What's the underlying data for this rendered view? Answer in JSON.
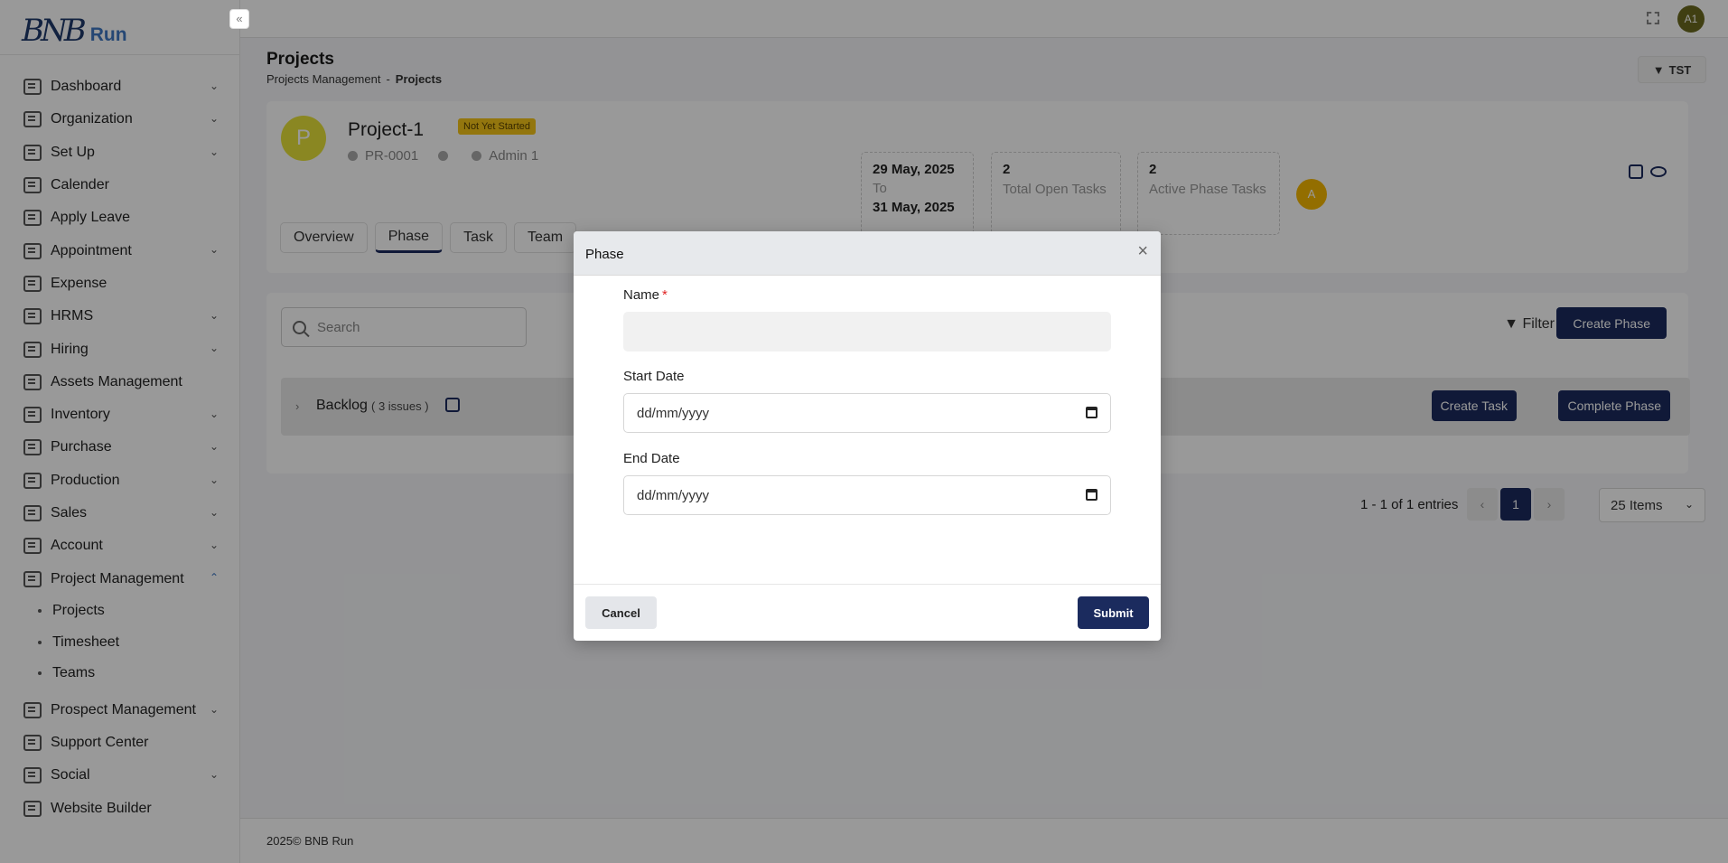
{
  "app": {
    "logo_mark": "BNB",
    "logo_text": "Run",
    "collapse_glyph": "«",
    "user_initials": "A1"
  },
  "sidebar": {
    "items": [
      {
        "label": "Dashboard",
        "icon": "dashboard-icon",
        "has_children": true
      },
      {
        "label": "Organization",
        "icon": "organization-icon",
        "has_children": true
      },
      {
        "label": "Set Up",
        "icon": "setup-icon",
        "has_children": true
      },
      {
        "label": "Calender",
        "icon": "calendar-icon",
        "has_children": false
      },
      {
        "label": "Apply Leave",
        "icon": "leave-icon",
        "has_children": false
      },
      {
        "label": "Appointment",
        "icon": "appointment-icon",
        "has_children": true
      },
      {
        "label": "Expense",
        "icon": "expense-icon",
        "has_children": false
      },
      {
        "label": "HRMS",
        "icon": "hrms-icon",
        "has_children": true
      },
      {
        "label": "Hiring",
        "icon": "hiring-icon",
        "has_children": true
      },
      {
        "label": "Assets Management",
        "icon": "assets-icon",
        "has_children": false
      },
      {
        "label": "Inventory",
        "icon": "inventory-icon",
        "has_children": true
      },
      {
        "label": "Purchase",
        "icon": "purchase-icon",
        "has_children": true
      },
      {
        "label": "Production",
        "icon": "production-icon",
        "has_children": true
      },
      {
        "label": "Sales",
        "icon": "sales-icon",
        "has_children": true
      },
      {
        "label": "Account",
        "icon": "account-icon",
        "has_children": true
      },
      {
        "label": "Project Management",
        "icon": "project-icon",
        "has_children": true,
        "expanded": true
      }
    ],
    "project_sub": [
      "Projects",
      "Timesheet",
      "Teams"
    ],
    "items_after": [
      {
        "label": "Prospect Management",
        "icon": "prospect-icon",
        "has_children": true
      },
      {
        "label": "Support Center",
        "icon": "support-icon",
        "has_children": false
      },
      {
        "label": "Social",
        "icon": "social-icon",
        "has_children": true
      },
      {
        "label": "Website Builder",
        "icon": "website-icon",
        "has_children": false
      }
    ]
  },
  "header": {
    "title": "Projects",
    "breadcrumb_parent": "Projects Management",
    "breadcrumb_sep": "-",
    "breadcrumb_current": "Projects",
    "filter_button": "TST"
  },
  "project": {
    "avatar_letter": "P",
    "name": "Project-1",
    "status": "Not Yet Started",
    "code": "PR-0001",
    "owner": "Admin 1",
    "start_date": "29 May, 2025",
    "date_sep": "To",
    "end_date": "31 May, 2025",
    "open_tasks_count": "2",
    "open_tasks_label": "Total Open Tasks",
    "active_phase_count": "2",
    "active_phase_label": "Active Phase Tasks",
    "member_initial": "A"
  },
  "tabs": [
    "Overview",
    "Phase",
    "Task",
    "Team"
  ],
  "phase_section": {
    "search_placeholder": "Search",
    "filter_label": "Filter",
    "create_phase_label": "Create Phase",
    "backlog_name": "Backlog",
    "backlog_count": "( 3 issues )",
    "create_task_label": "Create Task",
    "complete_phase_label": "Complete Phase"
  },
  "pagination": {
    "entries_text": "1 - 1 of 1 entries",
    "current_page": "1",
    "items_per_page": "25 Items"
  },
  "footer": {
    "text": "2025© BNB Run"
  },
  "modal": {
    "title": "Phase",
    "name_label": "Name",
    "required_mark": "*",
    "name_value": "",
    "start_label": "Start Date",
    "start_placeholder": "dd/mm/yyyy",
    "end_label": "End Date",
    "end_placeholder": "dd/mm/yyyy",
    "cancel_label": "Cancel",
    "submit_label": "Submit"
  },
  "colors": {
    "primary": "#1b2b5e",
    "badge": "#f5c518",
    "project_avatar": "#e7e23a",
    "member_avatar": "#f5b800",
    "required": "#e02424"
  }
}
